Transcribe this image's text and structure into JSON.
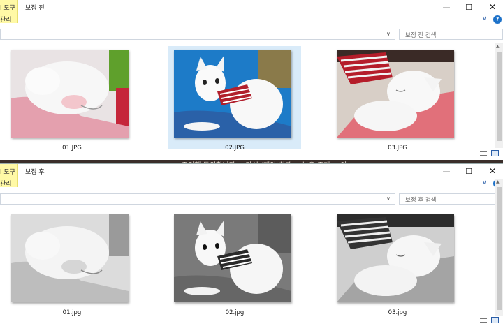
{
  "windows": [
    {
      "id": "top",
      "ribbon_tab_top": "l 도구",
      "ribbon_tab_bottom": "관리",
      "title": "보정 전",
      "search_placeholder": "보정 전 검색",
      "files": [
        {
          "name": "01.JPG",
          "selected": false
        },
        {
          "name": "02.JPG",
          "selected": true
        },
        {
          "name": "03.JPG",
          "selected": false
        }
      ]
    },
    {
      "id": "bottom",
      "ribbon_tab_top": "l 도구",
      "ribbon_tab_bottom": "관리",
      "title": "보정 후",
      "search_placeholder": "보정 후 검색",
      "files": [
        {
          "name": "01.jpg",
          "selected": false
        },
        {
          "name": "02.jpg",
          "selected": false
        },
        {
          "name": "03.jpg",
          "selected": false
        }
      ]
    }
  ],
  "controls": {
    "minimize": "—",
    "maximize": "☐",
    "close": "✕",
    "expand": "∨",
    "help": "?",
    "dropdown": "∨",
    "refresh": "↻"
  },
  "icons": [
    "minimize-icon",
    "maximize-icon",
    "close-icon",
    "help-icon",
    "refresh-icon",
    "details-view-icon",
    "thumbnails-view-icon"
  ],
  "colors": {
    "selection": "#d9ebf9",
    "tool_tab": "#fff9a6",
    "help": "#1e72c9",
    "desktop": "#3a2e2a"
  },
  "background_strip_text": "주의했 동의합니다 ~ 다시 (제안)하게 ~ 부우 주제 ~ 이"
}
